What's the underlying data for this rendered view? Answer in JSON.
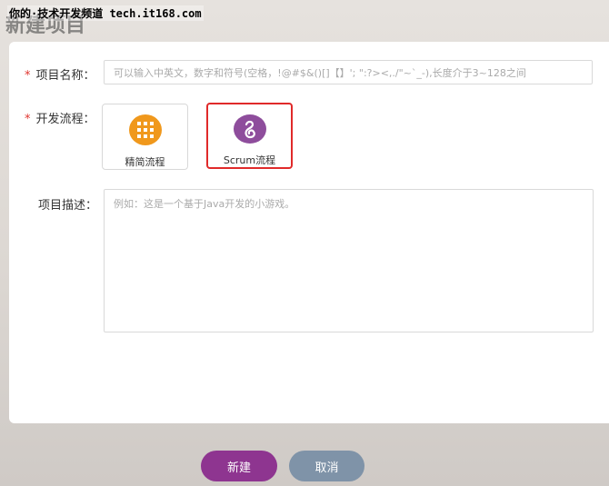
{
  "watermark": "你的·技术开发频道 tech.it168.com",
  "page": {
    "title": "新建项目"
  },
  "form": {
    "name": {
      "required_mark": "*",
      "label": "项目名称：",
      "placeholder": "可以输入中英文，数字和符号(空格，!@#$&()[]【】';  \":?><,./\"~`_-),长度介于3~128之间"
    },
    "flow": {
      "required_mark": "*",
      "label": "开发流程：",
      "options": [
        {
          "label": "精简流程",
          "icon": "grid-icon",
          "color": "#f0981c",
          "selected": false
        },
        {
          "label": "Scrum流程",
          "icon": "scrum-icon",
          "color": "#8e4d9c",
          "selected": true
        }
      ]
    },
    "description": {
      "label": "项目描述：",
      "placeholder": "例如：这是一个基于Java开发的小游戏。"
    }
  },
  "buttons": {
    "create": "新建",
    "cancel": "取消"
  },
  "colors": {
    "accent": "#8e3590",
    "cancel": "#7f93a8",
    "required": "#e0342e",
    "selected_border": "#e02a2a"
  }
}
